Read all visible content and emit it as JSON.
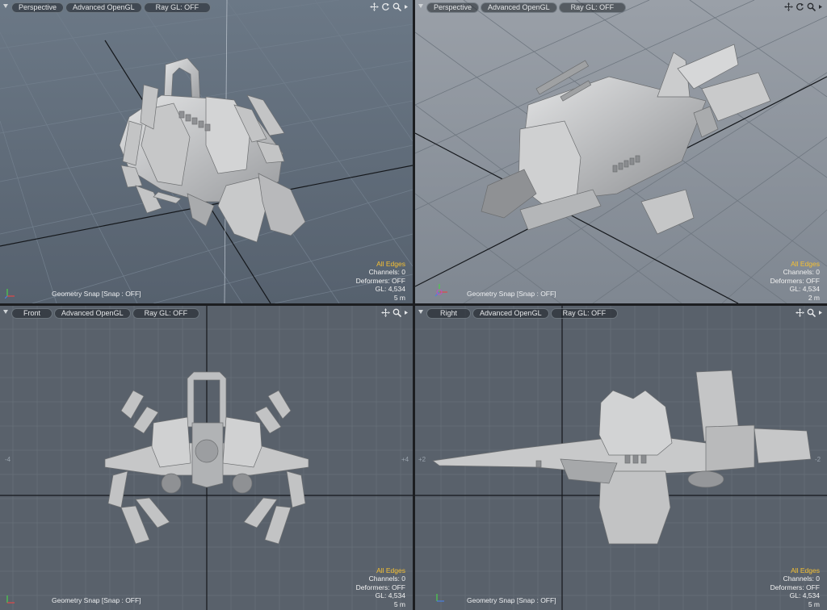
{
  "viewports": [
    {
      "id": "tl",
      "view": "Perspective",
      "shading": "Advanced OpenGL",
      "raygl": "Ray GL: OFF",
      "tools": [
        "move-icon",
        "rotate-icon",
        "zoom-icon",
        "menu-arrow-icon"
      ],
      "snap": "Geometry Snap  [Snap : OFF]",
      "info": {
        "mode": "All Edges",
        "channels": "Channels: 0",
        "deformers": "Deformers: OFF",
        "gl": "GL: 4,534",
        "scale": "5 m"
      }
    },
    {
      "id": "tr",
      "view": "Perspective",
      "shading": "Advanced OpenGL",
      "raygl": "Ray GL: OFF",
      "tools": [
        "move-icon",
        "rotate-icon",
        "zoom-icon",
        "menu-arrow-icon"
      ],
      "snap": "Geometry Snap  [Snap : OFF]",
      "info": {
        "mode": "All Edges",
        "channels": "Channels: 0",
        "deformers": "Deformers: OFF",
        "gl": "GL: 4,534",
        "scale": "2 m"
      }
    },
    {
      "id": "bl",
      "view": "Front",
      "shading": "Advanced OpenGL",
      "raygl": "Ray GL: OFF",
      "tools": [
        "move-icon",
        "zoom-icon",
        "menu-arrow-icon"
      ],
      "snap": "Geometry Snap  [Snap : OFF]",
      "info": {
        "mode": "All Edges",
        "channels": "Channels: 0",
        "deformers": "Deformers: OFF",
        "gl": "GL: 4,534",
        "scale": "5 m"
      }
    },
    {
      "id": "br",
      "view": "Right",
      "shading": "Advanced OpenGL",
      "raygl": "Ray GL: OFF",
      "tools": [
        "move-icon",
        "zoom-icon",
        "menu-arrow-icon"
      ],
      "snap": "Geometry Snap  [Snap : OFF]",
      "info": {
        "mode": "All Edges",
        "channels": "Channels: 0",
        "deformers": "Deformers: OFF",
        "gl": "GL: 4,534",
        "scale": "5 m"
      }
    }
  ],
  "colors": {
    "perspective_bg": "#5b6877",
    "perspective_bg_light": "#8b929a",
    "ortho_bg": "#59616b",
    "accent": "#f5c033",
    "model": "#b9bbbd"
  }
}
